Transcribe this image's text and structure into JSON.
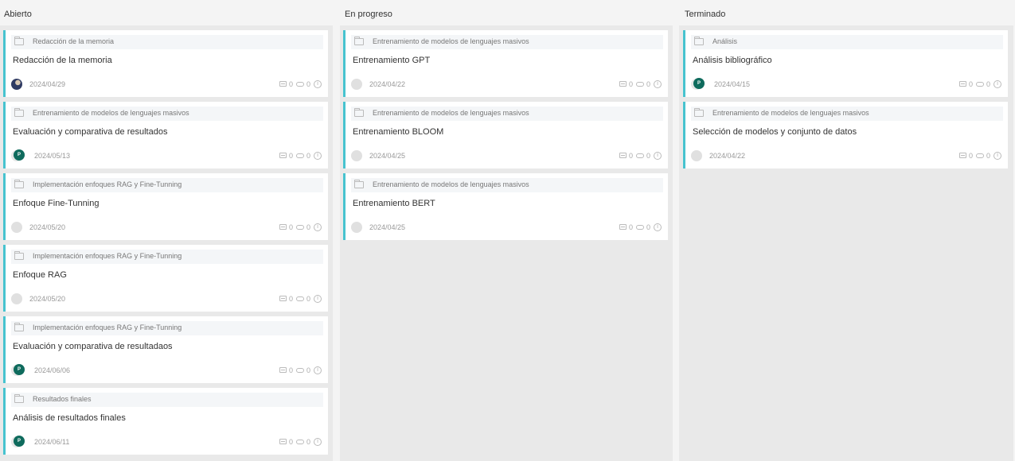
{
  "columns": [
    {
      "title": "Abierto",
      "cards": [
        {
          "category": "Redacción de la memoria",
          "title": "Redacción de la memoria",
          "date": "2024/04/29",
          "avatar": "photo",
          "comments": "0",
          "attachments": "0"
        },
        {
          "category": "Entrenamiento de modelos de lenguajes masivos",
          "title": "Evaluación y comparativa de resultados",
          "date": "2024/05/13",
          "avatar": "P",
          "comments": "0",
          "attachments": "0"
        },
        {
          "category": "Implementación enfoques RAG y Fine-Tunning",
          "title": "Enfoque Fine-Tunning",
          "date": "2024/05/20",
          "avatar": "empty",
          "comments": "0",
          "attachments": "0"
        },
        {
          "category": "Implementación enfoques RAG y Fine-Tunning",
          "title": "Enfoque RAG",
          "date": "2024/05/20",
          "avatar": "empty",
          "comments": "0",
          "attachments": "0"
        },
        {
          "category": "Implementación enfoques RAG y Fine-Tunning",
          "title": "Evaluación y comparativa de resultadaos",
          "date": "2024/06/06",
          "avatar": "P",
          "comments": "0",
          "attachments": "0"
        },
        {
          "category": "Resultados finales",
          "title": "Análisis de resultados finales",
          "date": "2024/06/11",
          "avatar": "P",
          "comments": "0",
          "attachments": "0"
        }
      ]
    },
    {
      "title": "En progreso",
      "cards": [
        {
          "category": "Entrenamiento de modelos de lenguajes masivos",
          "title": "Entrenamiento GPT",
          "date": "2024/04/22",
          "avatar": "empty",
          "comments": "0",
          "attachments": "0"
        },
        {
          "category": "Entrenamiento de modelos de lenguajes masivos",
          "title": "Entrenamiento BLOOM",
          "date": "2024/04/25",
          "avatar": "empty",
          "comments": "0",
          "attachments": "0"
        },
        {
          "category": "Entrenamiento de modelos de lenguajes masivos",
          "title": "Entrenamiento BERT",
          "date": "2024/04/25",
          "avatar": "empty",
          "comments": "0",
          "attachments": "0"
        }
      ]
    },
    {
      "title": "Terminado",
      "cards": [
        {
          "category": "Análisis",
          "title": "Análisis bibliográfico",
          "date": "2024/04/15",
          "avatar": "P",
          "comments": "0",
          "attachments": "0"
        },
        {
          "category": "Entrenamiento de modelos de lenguajes masivos",
          "title": "Selección de modelos y conjunto de datos",
          "date": "2024/04/22",
          "avatar": "empty",
          "comments": "0",
          "attachments": "0"
        }
      ]
    }
  ],
  "icons": {
    "category": "folder-icon",
    "comments": "comment-icon",
    "attachments": "attachment-icon",
    "info": "info-icon"
  },
  "colors": {
    "card_accent": "#47c3cf",
    "avatar_badge": "#0f6b5d",
    "column_background": "#e9e9e9"
  },
  "info_glyph": "i"
}
